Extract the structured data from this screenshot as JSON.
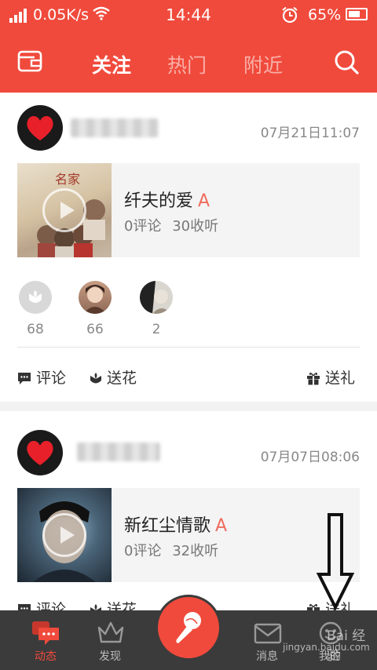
{
  "status_bar": {
    "network_speed": "0.05K/s",
    "time": "14:44",
    "battery": "65%"
  },
  "header": {
    "tabs": [
      {
        "label": "关注",
        "active": true
      },
      {
        "label": "热门",
        "active": false
      },
      {
        "label": "附近",
        "active": false
      }
    ],
    "icons": [
      "wallet-icon",
      "search-icon"
    ]
  },
  "feed": [
    {
      "datetime": "07月21日11:07",
      "song_title": "纤夫的爱",
      "badge": "A",
      "comments": "0评论",
      "listens": "30收听",
      "gifts": [
        {
          "count": "68",
          "icon": "flower-icon"
        },
        {
          "count": "66",
          "icon": "avatar"
        },
        {
          "count": "2",
          "icon": "avatar"
        }
      ],
      "actions": {
        "comment": "评论",
        "flower": "送花",
        "gift": "送礼"
      }
    },
    {
      "datetime": "07月07日08:06",
      "song_title": "新红尘情歌",
      "badge": "A",
      "comments": "0评论",
      "listens": "32收听",
      "actions": {
        "comment": "评论",
        "flower": "送花",
        "gift": "送礼"
      }
    }
  ],
  "tab_bar": {
    "items": [
      {
        "label": "动态",
        "active": true
      },
      {
        "label": "发现",
        "active": false
      },
      {
        "label": "消息",
        "active": false
      },
      {
        "label": "我的",
        "active": false
      }
    ]
  },
  "watermark": {
    "top": "Bai 经验",
    "bottom": "jingyan.baidu.com"
  },
  "colors": {
    "accent": "#f04a3c",
    "tabbar": "#3b3b3b",
    "badge": "#f06b5d"
  }
}
